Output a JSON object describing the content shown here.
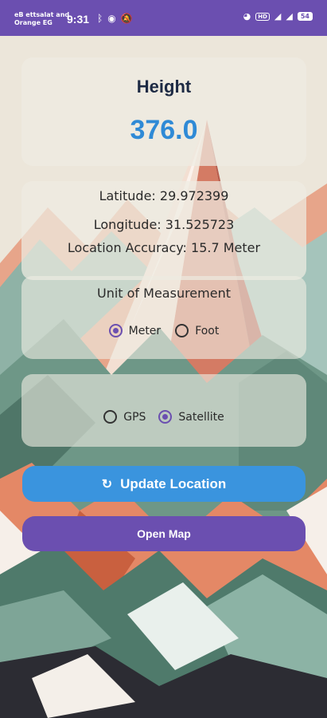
{
  "status_bar": {
    "carrier_line1": "eB ettsalat and",
    "carrier_line2": "Orange EG",
    "time": "9:31",
    "icons_left": [
      "bluetooth-icon",
      "location-icon",
      "mute-icon"
    ],
    "hd_label": "HD",
    "battery": "54"
  },
  "height_card": {
    "label": "Height",
    "value": "376.0"
  },
  "location_card": {
    "latitude": "Latitude: 29.972399",
    "longitude": "Longitude: 31.525723",
    "accuracy": "Location Accuracy: 15.7 Meter"
  },
  "unit_card": {
    "title": "Unit of Measurement",
    "options": [
      {
        "label": "Meter",
        "selected": true
      },
      {
        "label": "Foot",
        "selected": false
      }
    ]
  },
  "source_card": {
    "options": [
      {
        "label": "GPS",
        "selected": false
      },
      {
        "label": "Satellite",
        "selected": true
      }
    ]
  },
  "buttons": {
    "update_location": "Update Location",
    "open_map": "Open Map"
  },
  "colors": {
    "status_bar": "#6b4fb0",
    "accent_blue": "#3a94de",
    "accent_purple": "#6b4fb0",
    "height_value": "#2f8ad6"
  }
}
